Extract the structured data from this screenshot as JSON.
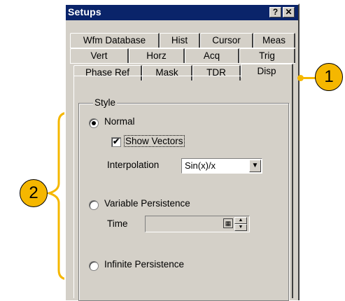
{
  "window": {
    "title": "Setups",
    "help_label": "?",
    "close_label": "✕"
  },
  "tabs": {
    "row1": [
      "Wfm Database",
      "Hist",
      "Cursor",
      "Meas"
    ],
    "row2": [
      "Vert",
      "Horz",
      "Acq",
      "Trig"
    ],
    "row3": [
      "Phase Ref",
      "Mask",
      "TDR",
      "Disp"
    ],
    "active": "Disp"
  },
  "style_group": {
    "legend": "Style",
    "normal_label": "Normal",
    "normal_selected": true,
    "show_vectors_label": "Show Vectors",
    "show_vectors_checked": true,
    "interpolation_label": "Interpolation",
    "interpolation_value": "Sin(x)/x",
    "variable_persistence_label": "Variable Persistence",
    "variable_persistence_selected": false,
    "time_label": "Time",
    "time_value": "",
    "infinite_persistence_label": "Infinite Persistence",
    "infinite_persistence_selected": false
  },
  "callouts": {
    "one": "1",
    "two": "2",
    "color": "#f5b700"
  },
  "icons": {
    "check": "✔",
    "dropdown": "▼",
    "keypad": "▦",
    "spin_up": "▲",
    "spin_down": "▼"
  }
}
